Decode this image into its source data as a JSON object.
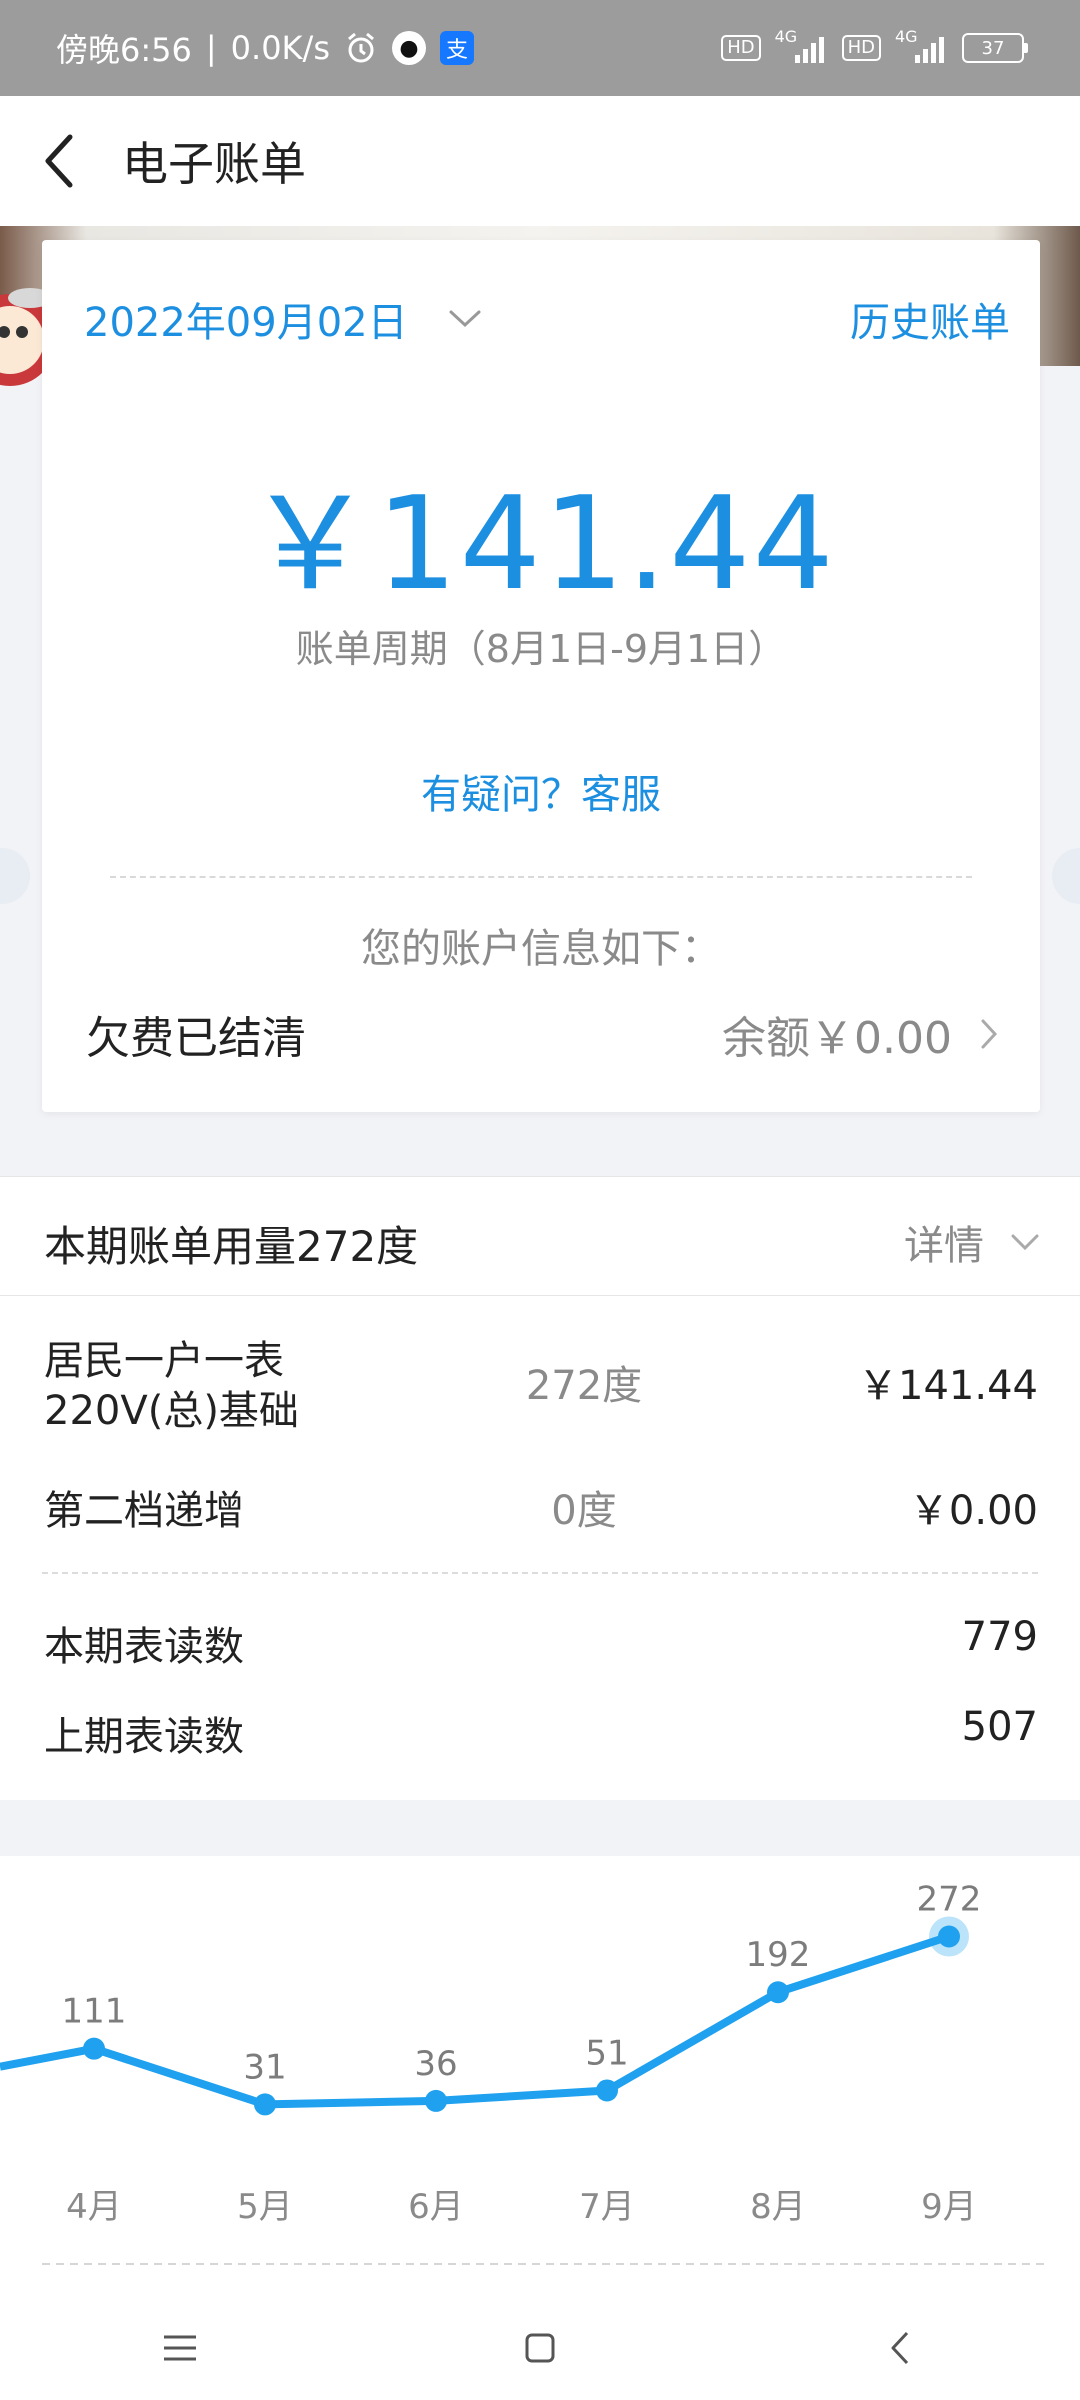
{
  "status_bar": {
    "time": "傍晚6:56",
    "speed": "0.0K/s",
    "left_icons": [
      "alarm-icon",
      "qq-icon",
      "alipay-icon"
    ],
    "network_labels": [
      "HD",
      "4G",
      "HD",
      "4G"
    ],
    "battery": "37"
  },
  "header": {
    "title": "电子账单"
  },
  "bill": {
    "date": "2022年09月02日",
    "history_link": "历史账单",
    "amount": "￥141.44",
    "period": "账单周期（8月1日-9月1日）",
    "help_link": "有疑问？客服",
    "account_info_label": "您的账户信息如下：",
    "arrears_status": "欠费已结清",
    "balance": "余额￥0.00"
  },
  "usage": {
    "title": "本期账单用量272度",
    "detail_label": "详情",
    "rows": [
      {
        "name": "居民一户一表220V(总)基础",
        "quantity": "272度",
        "cost": "￥141.44"
      },
      {
        "name": "第二档递增",
        "quantity": "0度",
        "cost": "￥0.00"
      }
    ],
    "readings": [
      {
        "label": "本期表读数",
        "value": "779"
      },
      {
        "label": "上期表读数",
        "value": "507"
      }
    ]
  },
  "colors": {
    "accent": "#1d8fe1",
    "line": "#1fa1ef",
    "muted": "#8a8a8a"
  },
  "chart_data": {
    "type": "line",
    "categories": [
      "4月",
      "5月",
      "6月",
      "7月",
      "8月",
      "9月"
    ],
    "values": [
      111,
      31,
      36,
      51,
      192,
      272
    ],
    "highlight": "9月",
    "ylim": [
      0,
      300
    ]
  }
}
